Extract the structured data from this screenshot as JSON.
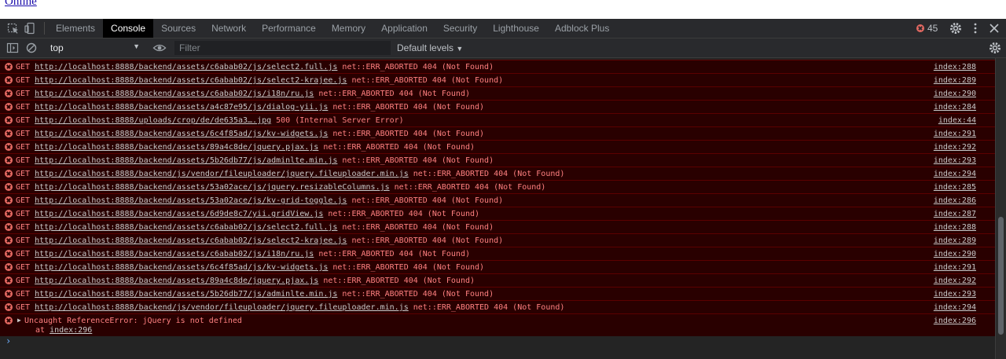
{
  "page": {
    "link_text": "Online"
  },
  "devtools": {
    "tabs": [
      "Elements",
      "Console",
      "Sources",
      "Network",
      "Performance",
      "Memory",
      "Application",
      "Security",
      "Lighthouse",
      "Adblock Plus"
    ],
    "active_tab": "Console",
    "error_count": "45"
  },
  "toolbar": {
    "context": "top",
    "filter_placeholder": "Filter",
    "levels": "Default levels"
  },
  "messages": [
    {
      "method": "GET ",
      "url": "http://localhost:8888/backend/assets/c6abab02/js/select2.full.js",
      "status": " net::ERR_ABORTED 404 (Not Found)",
      "source": "index:288"
    },
    {
      "method": "GET ",
      "url": "http://localhost:8888/backend/assets/c6abab02/js/select2-krajee.js",
      "status": " net::ERR_ABORTED 404 (Not Found)",
      "source": "index:289"
    },
    {
      "method": "GET ",
      "url": "http://localhost:8888/backend/assets/c6abab02/js/i18n/ru.js",
      "status": " net::ERR_ABORTED 404 (Not Found)",
      "source": "index:290"
    },
    {
      "method": "GET ",
      "url": "http://localhost:8888/backend/assets/a4c87e95/js/dialog-yii.js",
      "status": " net::ERR_ABORTED 404 (Not Found)",
      "source": "index:284"
    },
    {
      "method": "GET ",
      "url": "http://localhost:8888/uploads/crop/de/de635a3….jpg",
      "status": " 500 (Internal Server Error)",
      "source": "index:44"
    },
    {
      "method": "GET ",
      "url": "http://localhost:8888/backend/assets/6c4f85ad/js/kv-widgets.js",
      "status": " net::ERR_ABORTED 404 (Not Found)",
      "source": "index:291"
    },
    {
      "method": "GET ",
      "url": "http://localhost:8888/backend/assets/89a4c8de/jquery.pjax.js",
      "status": " net::ERR_ABORTED 404 (Not Found)",
      "source": "index:292"
    },
    {
      "method": "GET ",
      "url": "http://localhost:8888/backend/assets/5b26db77/js/adminlte.min.js",
      "status": " net::ERR_ABORTED 404 (Not Found)",
      "source": "index:293"
    },
    {
      "method": "GET ",
      "url": "http://localhost:8888/backend/js/vendor/fileuploader/jquery.fileuploader.min.js",
      "status": " net::ERR_ABORTED 404 (Not Found)",
      "source": "index:294"
    },
    {
      "method": "GET ",
      "url": "http://localhost:8888/backend/assets/53a02ace/js/jquery.resizableColumns.js",
      "status": " net::ERR_ABORTED 404 (Not Found)",
      "source": "index:285"
    },
    {
      "method": "GET ",
      "url": "http://localhost:8888/backend/assets/53a02ace/js/kv-grid-toggle.js",
      "status": " net::ERR_ABORTED 404 (Not Found)",
      "source": "index:286"
    },
    {
      "method": "GET ",
      "url": "http://localhost:8888/backend/assets/6d9de8c7/yii.gridView.js",
      "status": " net::ERR_ABORTED 404 (Not Found)",
      "source": "index:287"
    },
    {
      "method": "GET ",
      "url": "http://localhost:8888/backend/assets/c6abab02/js/select2.full.js",
      "status": " net::ERR_ABORTED 404 (Not Found)",
      "source": "index:288"
    },
    {
      "method": "GET ",
      "url": "http://localhost:8888/backend/assets/c6abab02/js/select2-krajee.js",
      "status": " net::ERR_ABORTED 404 (Not Found)",
      "source": "index:289"
    },
    {
      "method": "GET ",
      "url": "http://localhost:8888/backend/assets/c6abab02/js/i18n/ru.js",
      "status": " net::ERR_ABORTED 404 (Not Found)",
      "source": "index:290"
    },
    {
      "method": "GET ",
      "url": "http://localhost:8888/backend/assets/6c4f85ad/js/kv-widgets.js",
      "status": " net::ERR_ABORTED 404 (Not Found)",
      "source": "index:291"
    },
    {
      "method": "GET ",
      "url": "http://localhost:8888/backend/assets/89a4c8de/jquery.pjax.js",
      "status": " net::ERR_ABORTED 404 (Not Found)",
      "source": "index:292"
    },
    {
      "method": "GET ",
      "url": "http://localhost:8888/backend/assets/5b26db77/js/adminlte.min.js",
      "status": " net::ERR_ABORTED 404 (Not Found)",
      "source": "index:293"
    },
    {
      "method": "GET ",
      "url": "http://localhost:8888/backend/js/vendor/fileuploader/jquery.fileuploader.min.js",
      "status": " net::ERR_ABORTED 404 (Not Found)",
      "source": "index:294"
    }
  ],
  "uncaught": {
    "text": "Uncaught ReferenceError: jQuery is not defined",
    "at_prefix": "at ",
    "at_link": "index:296",
    "source": "index:296"
  },
  "prompt": "›"
}
